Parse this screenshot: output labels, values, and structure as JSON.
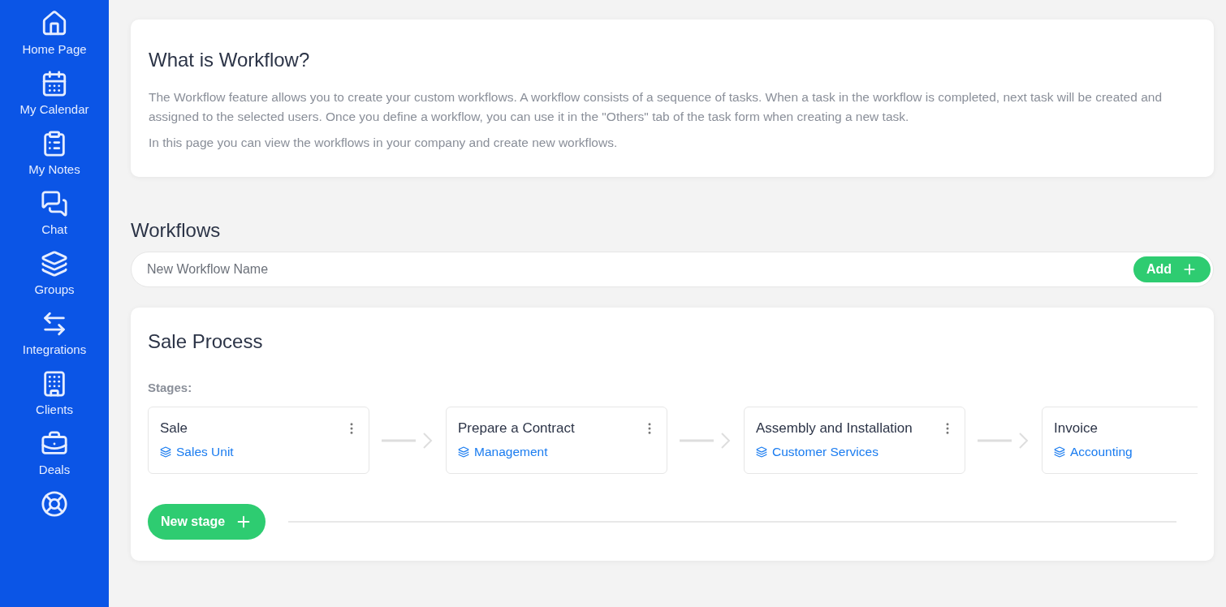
{
  "sidebar": {
    "items": [
      {
        "kind": "home",
        "label": "Home Page"
      },
      {
        "kind": "calendar",
        "label": "My Calendar"
      },
      {
        "kind": "notes",
        "label": "My Notes"
      },
      {
        "kind": "chat",
        "label": "Chat"
      },
      {
        "kind": "groups",
        "label": "Groups"
      },
      {
        "kind": "integrations",
        "label": "Integrations"
      },
      {
        "kind": "clients",
        "label": "Clients"
      },
      {
        "kind": "deals",
        "label": "Deals"
      },
      {
        "kind": "support"
      }
    ]
  },
  "intro": {
    "title": "What is Workflow?",
    "paragraphs": [
      "The Workflow feature allows you to create your custom workflows. A workflow consists of a sequence of tasks. When a task in the workflow is completed, next task will be created and assigned to the selected users. Once you define a workflow, you can use it in the \"Others\" tab of the task form when creating a new task.",
      "In this page you can view the workflows in your company and create new workflows."
    ]
  },
  "workflows": {
    "heading": "Workflows",
    "new_name": {
      "placeholder": "New Workflow Name"
    },
    "add_button": "Add"
  },
  "workflow": {
    "title": "Sale Process",
    "stages_label": "Stages:",
    "stages": [
      {
        "name": "Sale",
        "group": "Sales Unit"
      },
      {
        "name": "Prepare a Contract",
        "group": "Management"
      },
      {
        "name": "Assembly and Installation",
        "group": "Customer Services"
      },
      {
        "name": "Invoice",
        "group": "Accounting"
      }
    ],
    "new_stage_button": "New stage"
  }
}
